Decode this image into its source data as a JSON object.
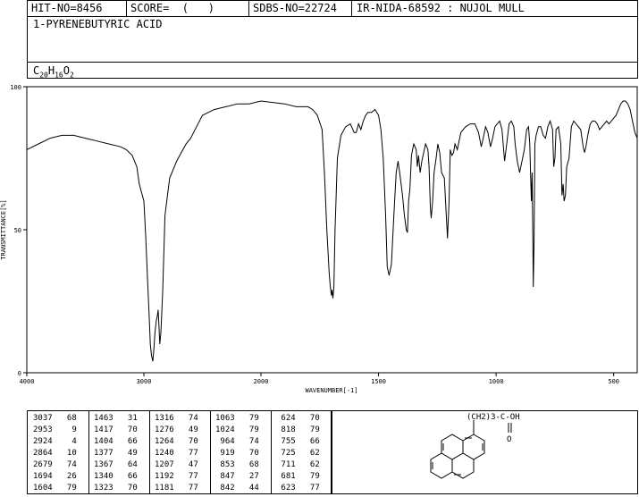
{
  "header": {
    "hit_no": "HIT-NO=8456",
    "score": "SCORE=  (   )",
    "sdbs_no": "SDBS-NO=22724",
    "ir_info": "IR-NIDA-68592 : NUJOL MULL",
    "compound": "1-PYRENEBUTYRIC ACID",
    "formula": {
      "C": "20",
      "H": "16",
      "O": "2"
    }
  },
  "chart_data": {
    "type": "line",
    "xlabel": "WAVENUMBER[-1]",
    "ylabel": "TRANSMITTANCE[%]",
    "xlim": [
      4000,
      400
    ],
    "ylim": [
      0,
      100
    ],
    "x_ticks": [
      4000,
      3000,
      2000,
      1500,
      1000,
      500
    ],
    "y_ticks": [
      0,
      50,
      100
    ],
    "series": [
      {
        "x": [
          4000,
          3900,
          3800,
          3700,
          3600,
          3500,
          3400,
          3300,
          3200,
          3150,
          3100,
          3060,
          3040,
          3020,
          3000,
          2985,
          2970,
          2955,
          2945,
          2935,
          2924,
          2915,
          2905,
          2895,
          2885,
          2878,
          2864,
          2855,
          2840,
          2820,
          2780,
          2720,
          2680,
          2640,
          2600,
          2550,
          2500,
          2400,
          2300,
          2200,
          2100,
          2000,
          1900,
          1850,
          1800,
          1780,
          1760,
          1740,
          1730,
          1720,
          1710,
          1705,
          1700,
          1698,
          1694,
          1690,
          1685,
          1675,
          1660,
          1640,
          1620,
          1604,
          1595,
          1585,
          1575,
          1565,
          1555,
          1545,
          1530,
          1515,
          1500,
          1490,
          1480,
          1470,
          1463,
          1455,
          1445,
          1435,
          1425,
          1417,
          1410,
          1404,
          1398,
          1390,
          1382,
          1377,
          1372,
          1367,
          1360,
          1350,
          1340,
          1335,
          1330,
          1323,
          1316,
          1300,
          1290,
          1285,
          1280,
          1276,
          1270,
          1264,
          1255,
          1248,
          1240,
          1232,
          1220,
          1207,
          1200,
          1195,
          1192,
          1188,
          1181,
          1175,
          1165,
          1150,
          1130,
          1110,
          1090,
          1075,
          1063,
          1055,
          1045,
          1035,
          1024,
          1015,
          1005,
          995,
          985,
          975,
          964,
          955,
          945,
          935,
          925,
          919,
          910,
          900,
          890,
          880,
          870,
          862,
          857,
          853,
          850,
          847,
          844,
          842,
          839,
          835,
          830,
          820,
          810,
          800,
          790,
          780,
          770,
          760,
          755,
          750,
          745,
          735,
          725,
          720,
          715,
          711,
          705,
          700,
          690,
          680,
          670,
          660,
          650,
          640,
          630,
          624,
          618,
          610,
          600,
          590,
          580,
          570,
          560,
          550,
          540,
          530,
          520,
          510,
          500,
          490,
          480,
          470,
          460,
          450,
          440,
          430,
          420,
          410,
          400
        ],
        "y": [
          78,
          80,
          82,
          83,
          83,
          82,
          81,
          80,
          79,
          78,
          76,
          72,
          66,
          63,
          60,
          48,
          34,
          20,
          10,
          6,
          4,
          8,
          14,
          18,
          20,
          22,
          10,
          14,
          28,
          55,
          68,
          74,
          77,
          80,
          82,
          86,
          90,
          92,
          93,
          94,
          94,
          95,
          94,
          93,
          93,
          92,
          90,
          85,
          70,
          50,
          35,
          30,
          27,
          29,
          26,
          30,
          50,
          75,
          83,
          86,
          87,
          84,
          84,
          87,
          85,
          88,
          90,
          91,
          91,
          92,
          90,
          85,
          75,
          55,
          37,
          34,
          38,
          55,
          70,
          74,
          70,
          66,
          62,
          55,
          50,
          49,
          60,
          64,
          76,
          80,
          78,
          72,
          76,
          70,
          74,
          80,
          78,
          72,
          58,
          54,
          60,
          70,
          75,
          80,
          77,
          70,
          68,
          47,
          60,
          78,
          77,
          76,
          77,
          80,
          78,
          84,
          86,
          87,
          87,
          84,
          79,
          82,
          86,
          84,
          79,
          82,
          86,
          87,
          88,
          85,
          74,
          80,
          87,
          88,
          86,
          80,
          74,
          70,
          74,
          78,
          85,
          86,
          80,
          68,
          60,
          70,
          47,
          30,
          44,
          80,
          83,
          86,
          86,
          83,
          82,
          86,
          88,
          85,
          72,
          75,
          85,
          86,
          80,
          62,
          66,
          60,
          62,
          72,
          75,
          86,
          88,
          87,
          86,
          85,
          79,
          77,
          79,
          83,
          87,
          88,
          88,
          87,
          85,
          86,
          87,
          88,
          87,
          88,
          89,
          90,
          92,
          94,
          95,
          95,
          94,
          92,
          88,
          84,
          82
        ]
      }
    ],
    "grid": false,
    "legend": "none"
  },
  "peak_table": [
    [
      [
        "3037",
        "68"
      ],
      [
        "2953",
        "9"
      ],
      [
        "2924",
        "4"
      ],
      [
        "2864",
        "10"
      ],
      [
        "2679",
        "74"
      ],
      [
        "1694",
        "26"
      ],
      [
        "1604",
        "79"
      ]
    ],
    [
      [
        "1463",
        "31"
      ],
      [
        "1417",
        "70"
      ],
      [
        "1404",
        "66"
      ],
      [
        "1377",
        "49"
      ],
      [
        "1367",
        "64"
      ],
      [
        "1340",
        "66"
      ],
      [
        "1323",
        "70"
      ]
    ],
    [
      [
        "1316",
        "74"
      ],
      [
        "1276",
        "49"
      ],
      [
        "1264",
        "70"
      ],
      [
        "1240",
        "77"
      ],
      [
        "1207",
        "47"
      ],
      [
        "1192",
        "77"
      ],
      [
        "1181",
        "77"
      ]
    ],
    [
      [
        "1063",
        "79"
      ],
      [
        "1024",
        "79"
      ],
      [
        "964",
        "74"
      ],
      [
        "919",
        "70"
      ],
      [
        "853",
        "68"
      ],
      [
        "847",
        "27"
      ],
      [
        "842",
        "44"
      ]
    ],
    [
      [
        "624",
        "70"
      ],
      [
        "818",
        "79"
      ],
      [
        "755",
        "66"
      ],
      [
        "725",
        "62"
      ],
      [
        "711",
        "62"
      ],
      [
        "681",
        "79"
      ],
      [
        "623",
        "77"
      ]
    ]
  ],
  "structure": {
    "label": "(CH2)3-C-OH",
    "carbonyl_o": "O"
  }
}
